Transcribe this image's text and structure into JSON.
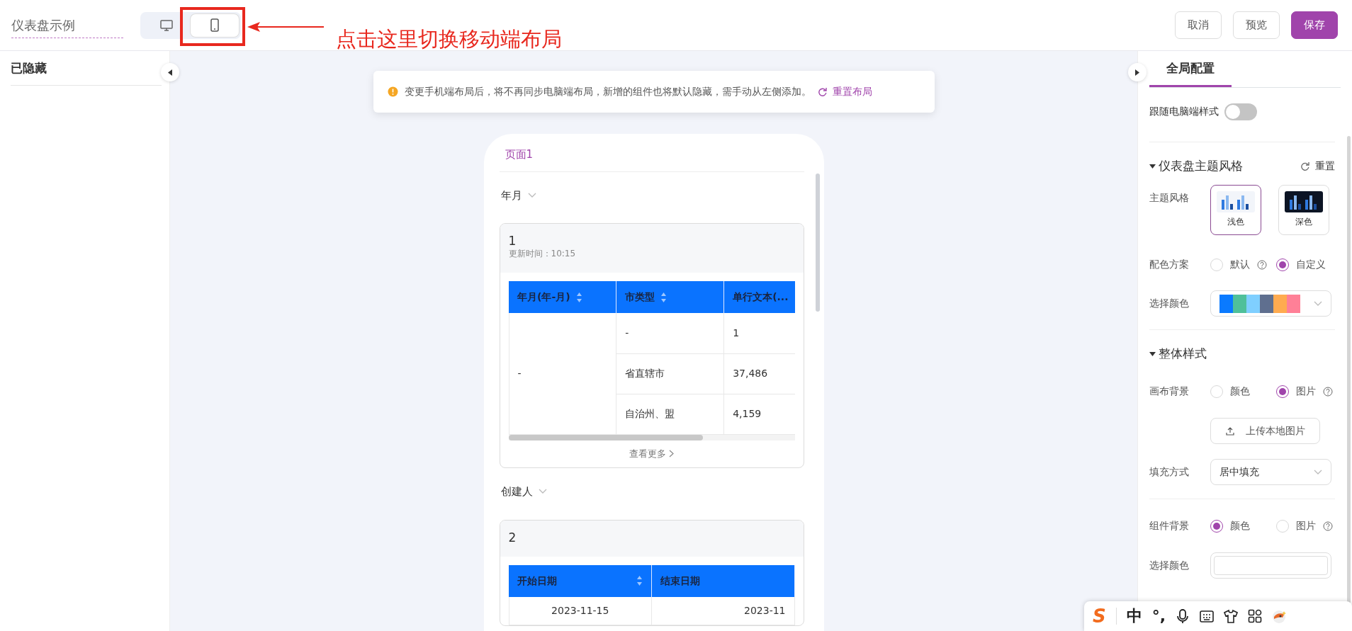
{
  "header": {
    "title": "仪表盘示例",
    "device_toggle": [
      {
        "kind": "desktop",
        "selected": false
      },
      {
        "kind": "mobile",
        "selected": true
      }
    ],
    "buttons": [
      {
        "label": "取消",
        "kind": "default"
      },
      {
        "label": "预览",
        "kind": "default"
      },
      {
        "label": "保存",
        "kind": "primary"
      }
    ]
  },
  "annotation": {
    "text": "点击这里切换移动端布局"
  },
  "left_panel": {
    "title": "已隐藏"
  },
  "notice": {
    "text": "变更手机端布局后，将不再同步电脑端布局，新增的组件也将默认隐藏，需手动从左侧添加。",
    "link": "重置布局"
  },
  "phone": {
    "page_title": "页面1",
    "widgets": [
      {
        "kind": "filter",
        "label": "年月"
      },
      {
        "kind": "table_card",
        "title": "1",
        "updated": "更新时间：10:15",
        "columns": [
          {
            "label": "年月(年-月)",
            "sortable": true
          },
          {
            "label": "市类型",
            "sortable": true
          },
          {
            "label": "单行文本(..."
          }
        ],
        "rows": [
          [
            {
              "text": "-",
              "rowspan": 3
            },
            "-",
            "1"
          ],
          [
            "省直辖市",
            "37,486"
          ],
          [
            "自治州、盟",
            "4,159"
          ]
        ],
        "footer": "查看更多"
      },
      {
        "kind": "filter",
        "label": "创建人"
      },
      {
        "kind": "table_card",
        "title": "2",
        "columns": [
          {
            "label": "开始日期",
            "sortable": true
          },
          {
            "label": "结束日期",
            "sortable": false
          }
        ],
        "rows": [
          [
            "2023-11-15",
            "2023-11"
          ]
        ]
      }
    ]
  },
  "right_panel": {
    "tabs": [
      {
        "label": "全局配置",
        "selected": true
      }
    ],
    "follow_desktop": {
      "label": "跟随电脑端样式",
      "on": false
    },
    "theme_section": {
      "title": "仪表盘主题风格",
      "expanded": true,
      "reset": "重置",
      "theme_label": "主题风格",
      "themes": [
        {
          "label": "浅色",
          "kind": "light",
          "selected": true
        },
        {
          "label": "深色",
          "kind": "dark",
          "selected": false
        }
      ],
      "scheme_label": "配色方案",
      "schemes": [
        {
          "label": "默认",
          "help": true,
          "selected": false
        },
        {
          "label": "自定义",
          "help": false,
          "selected": true
        }
      ],
      "color_label": "选择颜色",
      "palette": [
        {
          "color": "#0a7aff"
        },
        {
          "color": "#4fc09a"
        },
        {
          "color": "#7fcfff"
        },
        {
          "color": "#5f6f8f"
        },
        {
          "color": "#ffab50"
        },
        {
          "color": "#ff8097"
        }
      ]
    },
    "overall_section": {
      "title": "整体样式",
      "expanded": true,
      "canvas_bg_label": "画布背景",
      "canvas_bg_options": [
        {
          "label": "颜色",
          "help": false,
          "selected": false
        },
        {
          "label": "图片",
          "help": true,
          "selected": true
        }
      ],
      "upload_button": "上传本地图片",
      "fill_label": "填充方式",
      "fill_value": "居中填充",
      "component_bg_label": "组件背景",
      "component_bg_options": [
        {
          "label": "颜色",
          "help": false,
          "selected": true
        },
        {
          "label": "图片",
          "help": true,
          "selected": false
        }
      ],
      "component_color_label": "选择颜色"
    }
  },
  "ime_toolbar": {
    "items": [
      {
        "kind": "logo",
        "label": "S"
      },
      {
        "kind": "text",
        "label": "中"
      },
      {
        "kind": "text",
        "label": "°,"
      },
      {
        "kind": "mic"
      },
      {
        "kind": "keyboard"
      },
      {
        "kind": "shirt"
      },
      {
        "kind": "grid"
      },
      {
        "kind": "mascot"
      }
    ]
  }
}
